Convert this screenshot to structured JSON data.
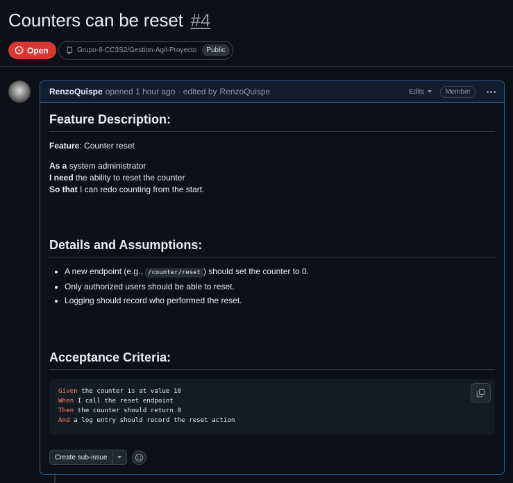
{
  "issue": {
    "title": "Counters can be reset",
    "number": "#4",
    "state": "Open",
    "repo": "Grupo-8-CC3S2/Gestion-Agil-Proyecto",
    "visibility": "Public"
  },
  "comment": {
    "author": "RenzoQuispe",
    "opened_text": "opened 1 hour ago",
    "edited_prefix": "· edited by",
    "editor": "RenzoQuispe",
    "edits_label": "Edits",
    "role_badge": "Member"
  },
  "body": {
    "feature_heading": "Feature Description:",
    "feature_label": "Feature",
    "feature_value": ": Counter reset",
    "as_a_label": "As a",
    "as_a_value": " system administrator",
    "i_need_label": "I need",
    "i_need_value": " the ability to reset the counter",
    "so_that_label": "So that",
    "so_that_value": " I can redo counting from the start.",
    "details_heading": "Details and Assumptions:",
    "bullet1_pre": "A new endpoint (e.g., ",
    "bullet1_code": "/counter/reset",
    "bullet1_post": ") should set the counter to 0.",
    "bullet2": "Only authorized users should be able to reset.",
    "bullet3": "Logging should record who performed the reset.",
    "acceptance_heading": "Acceptance Criteria:",
    "code": [
      {
        "kw": "Given",
        "text": " the counter is at value 10"
      },
      {
        "kw": "When",
        "text": " I call the reset endpoint"
      },
      {
        "kw": "Then",
        "text": " the counter should return 0"
      },
      {
        "kw": "And",
        "text": " a log entry should record the reset action"
      }
    ]
  },
  "footer": {
    "create_sub_issue_label": "Create sub-issue"
  },
  "colors": {
    "open_state": "#da3633",
    "keyword": "#ff7b72",
    "header_bg": "#121d2f",
    "border_accent": "#2f5d95"
  }
}
